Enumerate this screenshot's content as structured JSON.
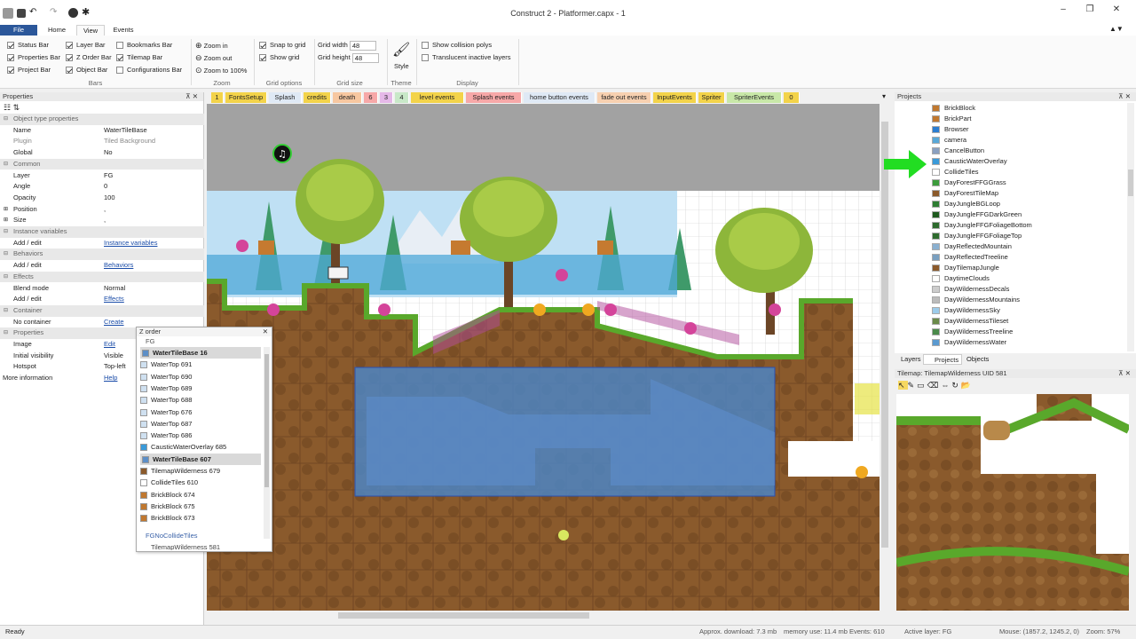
{
  "window": {
    "title": "Construct 2 - Platformer.capx - 1"
  },
  "ribbon_tabs": [
    "File",
    "Home",
    "View",
    "Events"
  ],
  "ribbon": {
    "bars": {
      "items": [
        {
          "label": "Status Bar",
          "checked": true
        },
        {
          "label": "Properties Bar",
          "checked": true
        },
        {
          "label": "Project Bar",
          "checked": true
        },
        {
          "label": "Layer Bar",
          "checked": true
        },
        {
          "label": "Z Order Bar",
          "checked": true
        },
        {
          "label": "Object Bar",
          "checked": true
        },
        {
          "label": "Bookmarks Bar",
          "checked": false
        },
        {
          "label": "Tilemap Bar",
          "checked": true
        },
        {
          "label": "Configurations Bar",
          "checked": false
        }
      ],
      "group": "Bars"
    },
    "zoom": {
      "items": [
        "Zoom in",
        "Zoom out",
        "Zoom to 100%"
      ],
      "group": "Zoom"
    },
    "grid_options": {
      "snap": "Snap to grid",
      "show": "Show grid",
      "group": "Grid options"
    },
    "grid_size": {
      "width_label": "Grid width",
      "width": "48",
      "height_label": "Grid height",
      "height": "48",
      "group": "Grid size"
    },
    "theme": {
      "label": "Style",
      "group": "Theme"
    },
    "display": {
      "items": [
        "Show collision polys",
        "Translucent inactive layers"
      ],
      "group": "Display"
    }
  },
  "properties": {
    "title": "Properties",
    "rows": [
      {
        "key": "Object type properties",
        "section": true
      },
      {
        "key": "Name",
        "value": "WaterTileBase"
      },
      {
        "key": "Plugin",
        "value": "Tiled Background",
        "gray": true
      },
      {
        "key": "Global",
        "value": "No"
      },
      {
        "key": "Common",
        "section": true
      },
      {
        "key": "Layer",
        "value": "FG"
      },
      {
        "key": "Angle",
        "value": "0"
      },
      {
        "key": "Opacity",
        "value": "100"
      },
      {
        "key": "Position",
        "value": ",",
        "exp": true
      },
      {
        "key": "Size",
        "value": ",",
        "exp": true
      },
      {
        "key": "Instance variables",
        "section": true
      },
      {
        "key": "Add / edit",
        "value": "Instance variables",
        "link": true
      },
      {
        "key": "Behaviors",
        "section": true
      },
      {
        "key": "Add / edit",
        "value": "Behaviors",
        "link": true
      },
      {
        "key": "Effects",
        "section": true
      },
      {
        "key": "Blend mode",
        "value": "Normal"
      },
      {
        "key": "Add / edit",
        "value": "Effects",
        "link": true
      },
      {
        "key": "Container",
        "section": true
      },
      {
        "key": "No container",
        "value": "Create",
        "link": true
      },
      {
        "key": "Properties",
        "section": true
      },
      {
        "key": "Image",
        "value": "Edit",
        "link": true
      },
      {
        "key": "Initial visibility",
        "value": "Visible"
      },
      {
        "key": "Hotspot",
        "value": "Top-left"
      },
      {
        "key": "More information",
        "value": "Help",
        "link": true,
        "nokey": true
      }
    ]
  },
  "zorder": {
    "title": "Z order",
    "layer": "FG",
    "items": [
      {
        "label": "WaterTileBase 16",
        "sel": true,
        "color": "#5d8fc7"
      },
      {
        "label": "WaterTop 691",
        "color": "#cfe0f0"
      },
      {
        "label": "WaterTop 690",
        "color": "#cfe0f0"
      },
      {
        "label": "WaterTop 689",
        "color": "#cfe0f0"
      },
      {
        "label": "WaterTop 688",
        "color": "#cfe0f0"
      },
      {
        "label": "WaterTop 676",
        "color": "#cfe0f0"
      },
      {
        "label": "WaterTop 687",
        "color": "#cfe0f0"
      },
      {
        "label": "WaterTop 686",
        "color": "#cfe0f0"
      },
      {
        "label": "CausticWaterOverlay 685",
        "color": "#3a9ad9"
      },
      {
        "label": "WaterTileBase 607",
        "sel": true,
        "color": "#5d8fc7"
      },
      {
        "label": "TilemapWilderness 679",
        "color": "#8b5a2b"
      },
      {
        "label": "CollideTiles 610",
        "color": "#ffffff"
      },
      {
        "label": "BrickBlock 674",
        "color": "#c07830"
      },
      {
        "label": "BrickBlock 675",
        "color": "#c07830"
      },
      {
        "label": "BrickBlock 673",
        "color": "#c07830"
      }
    ],
    "layer2": "FGNoCollideTiles",
    "cut": "TilemapWilderness 581"
  },
  "event_tabs": [
    {
      "label": "1",
      "color": "#f3d34a"
    },
    {
      "label": "FontsSetup",
      "color": "#f3d34a"
    },
    {
      "label": "Splash",
      "color": "#dfe9f5"
    },
    {
      "label": "credits",
      "color": "#f3d34a"
    },
    {
      "label": "death",
      "color": "#f7c7a0"
    },
    {
      "label": "6",
      "color": "#f7a8a8"
    },
    {
      "label": "3",
      "color": "#e5b8e8"
    },
    {
      "label": "4",
      "color": "#c8e8c8"
    },
    {
      "label": "level events",
      "color": "#f3d34a"
    },
    {
      "label": "Splash events",
      "color": "#f7a8a8"
    },
    {
      "label": "home button events",
      "color": "#dfe9f5"
    },
    {
      "label": "fade out events",
      "color": "#f7d0b0"
    },
    {
      "label": "InputEvents",
      "color": "#f3d34a"
    },
    {
      "label": "Spriter",
      "color": "#f3d34a"
    },
    {
      "label": "SpriterEvents",
      "color": "#c8e8a8"
    },
    {
      "label": "0",
      "color": "#f3d34a"
    }
  ],
  "projects": {
    "title": "Projects",
    "items": [
      {
        "label": "BrickBlock",
        "color": "#c07830"
      },
      {
        "label": "BrickPart",
        "color": "#c07830"
      },
      {
        "label": "Browser",
        "color": "#2a7dd1"
      },
      {
        "label": "camera",
        "color": "#58a8d8"
      },
      {
        "label": "CancelButton",
        "color": "#8aa0c0"
      },
      {
        "label": "CausticWaterOverlay",
        "color": "#3a9ad9"
      },
      {
        "label": "CollideTiles",
        "color": "#ffffff"
      },
      {
        "label": "DayForestFFGGrass",
        "color": "#3c9c3c"
      },
      {
        "label": "DayForestTileMap",
        "color": "#8b5a2b"
      },
      {
        "label": "DayJungleBGLoop",
        "color": "#2e7d32"
      },
      {
        "label": "DayJungleFFGDarkGreen",
        "color": "#1e5a1e"
      },
      {
        "label": "DayJungleFFGFoliageBottom",
        "color": "#2e6b2e"
      },
      {
        "label": "DayJungleFFGFoliageTop",
        "color": "#2e6b2e"
      },
      {
        "label": "DayReflectedMountain",
        "color": "#8ab0d0"
      },
      {
        "label": "DayReflectedTreeline",
        "color": "#7aa0c0"
      },
      {
        "label": "DayTilemapJungle",
        "color": "#8b5a2b"
      },
      {
        "label": "DaytimeClouds",
        "color": "#ffffff"
      },
      {
        "label": "DayWildernessDecals",
        "color": "#cccccc"
      },
      {
        "label": "DayWildernessMountains",
        "color": "#bbbbbb"
      },
      {
        "label": "DayWildernessSky",
        "color": "#9ccbea"
      },
      {
        "label": "DayWildernessTileset",
        "color": "#6a8a4a"
      },
      {
        "label": "DayWildernessTreeline",
        "color": "#4a8a4a"
      },
      {
        "label": "DayWildernessWater",
        "color": "#5a9ad0"
      }
    ]
  },
  "bottom_tabs": [
    "Layers",
    "Projects",
    "Objects"
  ],
  "tilemap": {
    "title": "Tilemap: TilemapWilderness UID 581"
  },
  "status": {
    "ready": "Ready",
    "download": "Approx. download: 7.3 mb",
    "memory": "memory use: 11.4 mb",
    "events": "Events: 610",
    "layer": "Active layer: FG",
    "mouse": "Mouse: (1857.2, 1245.2, 0)",
    "zoom": "Zoom: 57%"
  },
  "colors": {
    "accent": "#2b579a",
    "grass": "#59a82b",
    "dirt": "#8b5a2b",
    "water": "#4a86c8",
    "arrow": "#22dd22"
  }
}
